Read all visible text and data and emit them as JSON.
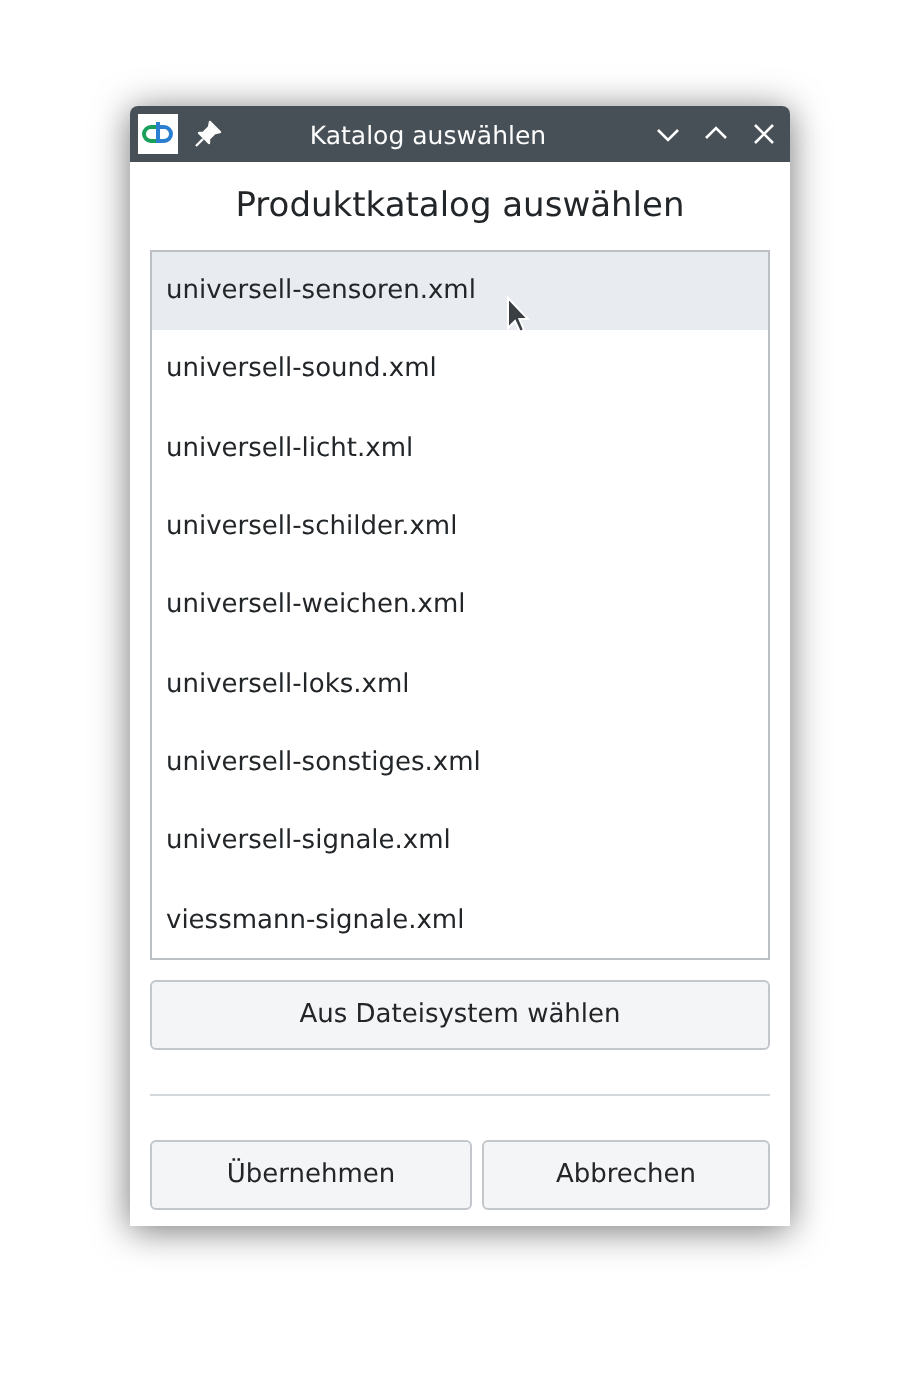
{
  "window": {
    "title": "Katalog auswählen"
  },
  "heading": "Produktkatalog auswählen",
  "catalogs": [
    {
      "label": "universell-sensoren.xml",
      "selected": true
    },
    {
      "label": "universell-sound.xml",
      "selected": false
    },
    {
      "label": "universell-licht.xml",
      "selected": false
    },
    {
      "label": "universell-schilder.xml",
      "selected": false
    },
    {
      "label": "universell-weichen.xml",
      "selected": false
    },
    {
      "label": "universell-loks.xml",
      "selected": false
    },
    {
      "label": "universell-sonstiges.xml",
      "selected": false
    },
    {
      "label": "universell-signale.xml",
      "selected": false
    },
    {
      "label": "viessmann-signale.xml",
      "selected": false
    }
  ],
  "file_button": "Aus Dateisystem wählen",
  "buttons": [
    "Übernehmen",
    "Abbrechen"
  ]
}
